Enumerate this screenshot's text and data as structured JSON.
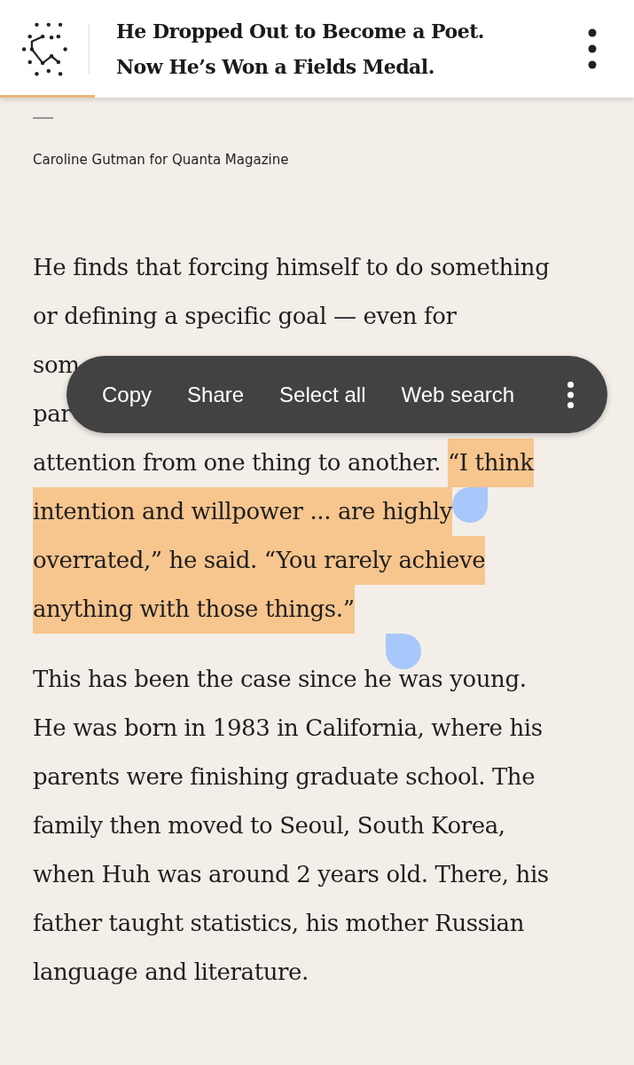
{
  "header": {
    "title_lines": [
      "He Dropped Out to Become a Poet.",
      "Now He’s Won a Fields Medal."
    ],
    "reading_progress": {
      "level": 0.15
    }
  },
  "photo_credit": "Caroline Gutman for Quanta Magazine",
  "paragraph_1": {
    "lines": [
      [
        {
          "text": "He finds that forcing himself to do something",
          "selected": false
        }
      ],
      [
        {
          "text": "or defining a specific goal — even for",
          "selected": false
        }
      ],
      [
        {
          "text": "som",
          "selected": false
        }
      ],
      [
        {
          "text": "par",
          "selected": false
        }
      ],
      [
        {
          "text": "attention from one thing to another. ",
          "selected": false
        },
        {
          "text": "“I think",
          "selected": true
        }
      ],
      [
        {
          "text": "intention and willpower ... are highly",
          "selected": true
        }
      ],
      [
        {
          "text": "overrated,” he said. “You rarely achieve",
          "selected": true
        }
      ],
      [
        {
          "text": "anything with those things.”",
          "selected": true
        }
      ]
    ]
  },
  "selection_menu": {
    "items": [
      "Copy",
      "Share",
      "Select all",
      "Web search"
    ]
  },
  "paragraph_2": {
    "lines": [
      "This has been the case since he was young.",
      "He was born in 1983 in California, where his",
      "parents were finishing graduate school. The",
      "family then moved to Seoul, South Korea,",
      "when Huh was around 2 years old. There, his",
      "father taught statistics, his mother Russian",
      "language and literature."
    ]
  }
}
